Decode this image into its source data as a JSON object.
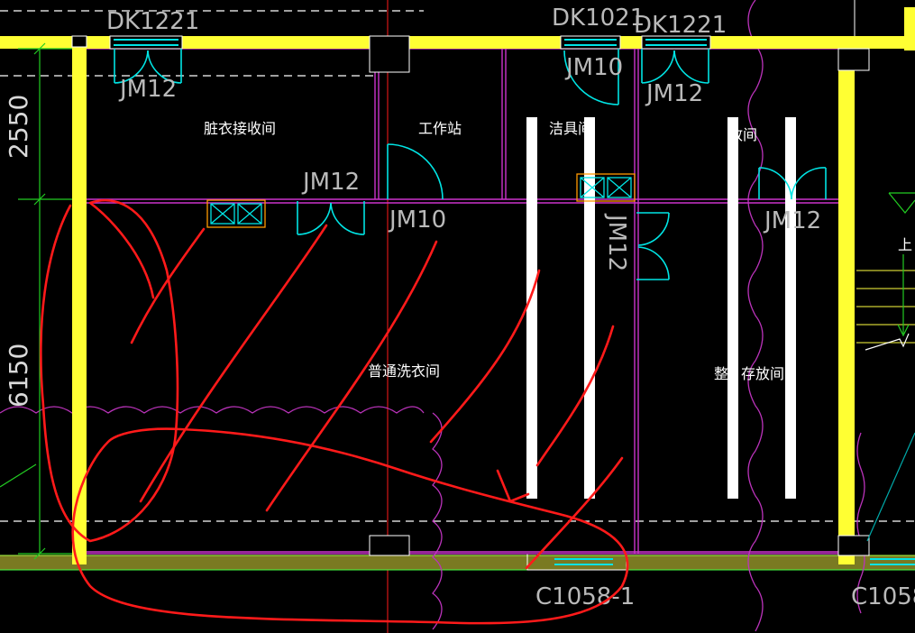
{
  "drawing": {
    "colors": {
      "background": "#000000",
      "wall": "#ffff33",
      "partition": "#cc33cc",
      "door": "#00e5e5",
      "annotation": "#ff1a1a",
      "ground": "#7a7a22",
      "dimension": "#22cc22",
      "vent_box": "#ff9900",
      "cloud": "#bb33bb"
    },
    "door_tags": {
      "dk1221_left": "DK1221",
      "dk1021": "DK1021",
      "dk1221_right": "DK1221",
      "jm12_a": "JM12",
      "jm10_a": "JM10",
      "jm12_b": "JM12",
      "jm12_c": "JM12",
      "jm10_b": "JM10",
      "jm12_vertical": "JM12",
      "jm12_d": "JM12"
    },
    "window_tags": {
      "c1058_1": "C1058-1",
      "c1058_right": "C1058"
    },
    "rooms": {
      "dirty_laundry": "脏衣接收间",
      "workstation": "工作站",
      "cleaning_tools": "洁具间",
      "storage_top": "放间",
      "general_laundry": "普通洗衣间",
      "storage_bottom_a": "整",
      "storage_bottom_b": "存放间"
    },
    "dimensions": {
      "top": "2550",
      "bottom": "6150"
    },
    "stair_label": "上"
  }
}
